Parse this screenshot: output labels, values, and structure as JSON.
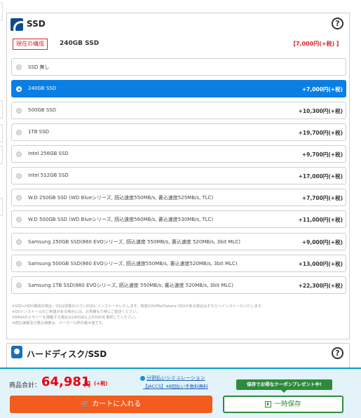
{
  "section": {
    "title": "SSD",
    "help": "?",
    "current": {
      "badge": "現在の構成",
      "name": "240GB SSD",
      "price": "【7,000円(+税) 】"
    },
    "options": [
      {
        "label": "SSD 無し",
        "price": "",
        "selected": false
      },
      {
        "label": "240GB SSD",
        "price": "+7,000円(+税)",
        "selected": true
      },
      {
        "label": "500GB SSD",
        "price": "+10,300円(+税)",
        "selected": false
      },
      {
        "label": "1TB SSD",
        "price": "+19,700円(+税)",
        "selected": false
      },
      {
        "label": "Intel 256GB SSD",
        "price": "+9,700円(+税)",
        "selected": false
      },
      {
        "label": "Intel 512GB SSD",
        "price": "+17,000円(+税)",
        "selected": false
      },
      {
        "label": "W.D 250GB SSD (WD Blueシリーズ, 読込速度550MB/s, 書込速度525MB/s, TLC)",
        "price": "+7,700円(+税)",
        "selected": false
      },
      {
        "label": "W.D 500GB SSD (WD Blueシリーズ, 読込速度560MB/s, 書込速度530MB/s, TLC)",
        "price": "+11,000円(+税)",
        "selected": false
      },
      {
        "label": "Samsung 250GB SSD(860 EVOシリーズ, 読込速度 550MB/s, 書込速度 520MB/s, 3bit MLC)",
        "price": "+9,000円(+税)",
        "selected": false
      },
      {
        "label": "Samsung 500GB SSD(860 EVOシリーズ, 読込速度550MB/s, 書込速度520MB/s, 3bit MLC)",
        "price": "+13,000円(+税)",
        "selected": false
      },
      {
        "label": "Samsung 1TB SSD(860 EVOシリーズ, 読込速度 550MB/s, 書込速度 520MB/s, 3bit MLC)",
        "price": "+22,300円(+税)",
        "selected": false
      }
    ],
    "notes": [
      "※SSD+HDD構成の場合、OSは容量の小さいSSDにインストールいたします。高速なNVMe/Optane SSDがある場合はそちらへインストールいたします。",
      "※OSインストールのご希望がある場合には、お見積もり時にご指定ください。",
      "※64bitのメモリーを搭載する場合は240GB以上のSSDを選択してください。",
      "※読込速度及び書込速度は、メーカー公称の最大値です。"
    ]
  },
  "section2": {
    "title": "ハードディスク/SSD",
    "help": "?"
  },
  "bottom": {
    "total_label": "商品合計：",
    "total_value": "64,981",
    "total_unit": "円",
    "total_tax": "(+税)",
    "link_simulation": "分割払いシミュレーション",
    "link_jaccs": "【JACCS】48回払い手数料無料",
    "promo": "保存でお得なクーポンプレゼント中!",
    "cart_label": "カートに入れる",
    "save_label": "一時保存"
  }
}
